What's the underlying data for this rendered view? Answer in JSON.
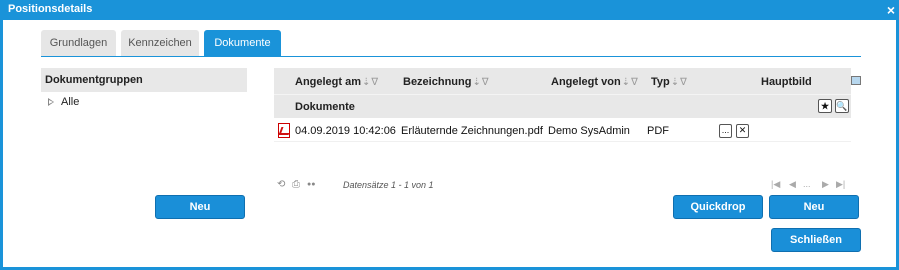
{
  "window": {
    "title": "Positionsdetails",
    "close_glyph": "×"
  },
  "tabs": [
    {
      "label": "Grundlagen"
    },
    {
      "label": "Kennzeichen"
    },
    {
      "label": "Dokumente",
      "active": true
    }
  ],
  "left_panel": {
    "header": "Dokumentgruppen",
    "items": [
      {
        "label": "Alle"
      }
    ],
    "new_button": "Neu"
  },
  "grid": {
    "columns": [
      {
        "label": "Angelegt am"
      },
      {
        "label": "Bezeichnung"
      },
      {
        "label": "Angelegt von"
      },
      {
        "label": "Typ"
      },
      {
        "label": "Hauptbild"
      }
    ],
    "sort_glyph": "⇣",
    "filter_glyph": "∇",
    "subheader": "Dokumente",
    "star_glyph": "★",
    "search_glyph": "🔍",
    "rows": [
      {
        "created": "04.09.2019 10:42:06",
        "name": "Erläuternde Zeichnungen.pdf",
        "creator": "Demo SysAdmin",
        "type": "PDF",
        "dots": "...",
        "x": "✕"
      }
    ]
  },
  "pager": {
    "refresh_glyph": "⟲",
    "print_glyph": "⎙",
    "settings_glyph": "●●",
    "status": "Datensätze 1 - 1 von 1",
    "first": "|◀",
    "prev": "◀",
    "ellipsis": "...",
    "next": "▶",
    "last": "▶|"
  },
  "buttons": {
    "quickdrop": "Quickdrop",
    "new": "Neu",
    "close": "Schließen"
  },
  "colors": {
    "accent": "#1a93d9",
    "header_bg": "#e8e8e8"
  }
}
